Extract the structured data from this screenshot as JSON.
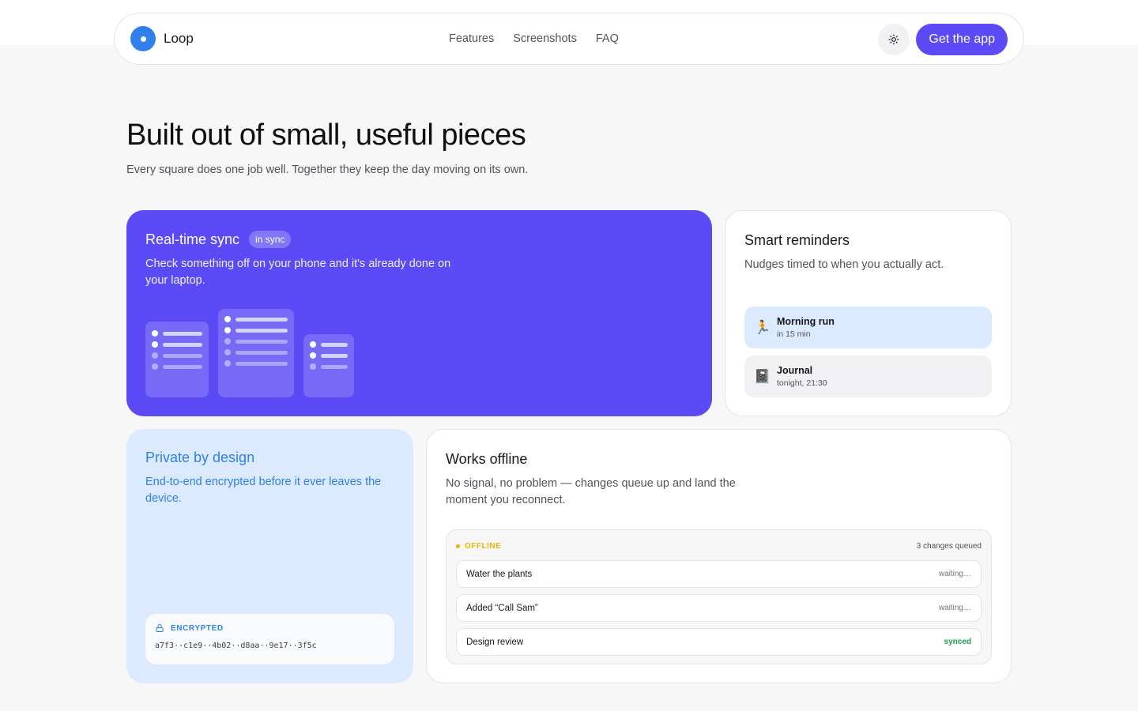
{
  "brand": {
    "name": "Loop",
    "color": "#2f80ed"
  },
  "nav": {
    "links": [
      "Features",
      "Screenshots",
      "FAQ"
    ],
    "theme_icon": "sun-icon",
    "cta": "Get the app",
    "accent": "#5b4af5"
  },
  "hero": {
    "title": "Built out of small, useful pieces",
    "subtitle": "Every square does one job well. Together they keep the day moving on its own."
  },
  "sync": {
    "title": "Real-time sync",
    "badge": "in sync",
    "description": "Check something off on your phone and it's already done on your laptop."
  },
  "reminders": {
    "title": "Smart reminders",
    "description": "Nudges timed to when you actually act.",
    "items": [
      {
        "icon": "🏃",
        "title": "Morning run",
        "time": "in 15 min"
      },
      {
        "icon": "📓",
        "title": "Journal",
        "time": "tonight, 21:30"
      }
    ]
  },
  "privacy": {
    "title": "Private by design",
    "description": "End-to-end encrypted before it ever leaves the device.",
    "label": "ENCRYPTED",
    "cipher": "a7f3··c1e9··4b02··d8aa··9e17··3f5c",
    "icon": "lock-icon"
  },
  "offline": {
    "title": "Works offline",
    "description": "No signal, no problem — changes queue up and land the moment you reconnect.",
    "status": "OFFLINE",
    "queued": "3 changes queued",
    "items": [
      {
        "name": "Water the plants",
        "state": "waiting…"
      },
      {
        "name": "Added “Call Sam”",
        "state": "waiting…"
      },
      {
        "name": "Design review",
        "state": "synced"
      }
    ]
  }
}
